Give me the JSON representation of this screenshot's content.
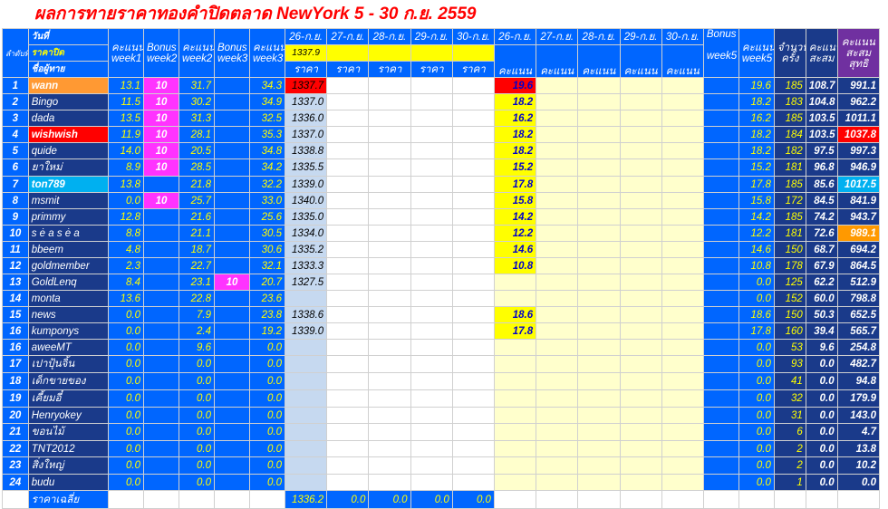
{
  "title": "ผลการทายราคาทองคำปิดตลาด NewYork 5 - 30 ก.ย. 2559",
  "header": {
    "rank_label": "ลำดับที่",
    "date_label": "วันที่",
    "close_label": "ราคาปิด",
    "name_label": "ชื่อผู้ทาย",
    "score_label": "คะแนน",
    "bonus_label": "Bonus",
    "week1": "week1",
    "week2": "week2",
    "week3": "week3",
    "week5": "week5",
    "price_label": "ราคา",
    "count_label": "จำนวนครั้ง",
    "accum_label": "คะแนนสะสม",
    "total_label": "คะแนนสะสมสุทธิ",
    "dates": [
      "26-ก.ย.",
      "27-ก.ย.",
      "28-ก.ย.",
      "29-ก.ย.",
      "30-ก.ย."
    ],
    "close_price_26": "1337.9"
  },
  "rows": [
    {
      "no": "1",
      "name": "wann",
      "w1": "13.1",
      "b2": "10",
      "w2": "31.7",
      "b3": "",
      "w3": "34.3",
      "p26": "1337.7",
      "s26": "19.6",
      "w5": "19.6",
      "cnt": "185",
      "acc": "108.7",
      "tot": "991.1",
      "nameHl": "orange",
      "priceHl": "red",
      "scoreHl": "red"
    },
    {
      "no": "2",
      "name": "Bingo",
      "w1": "11.5",
      "b2": "10",
      "w2": "30.2",
      "b3": "",
      "w3": "34.9",
      "p26": "1337.0",
      "s26": "18.2",
      "w5": "18.2",
      "cnt": "183",
      "acc": "104.8",
      "tot": "962.2"
    },
    {
      "no": "3",
      "name": "dada",
      "w1": "13.5",
      "b2": "10",
      "w2": "31.3",
      "b3": "",
      "w3": "32.5",
      "p26": "1336.0",
      "s26": "16.2",
      "w5": "16.2",
      "cnt": "185",
      "acc": "103.5",
      "tot": "1011.1"
    },
    {
      "no": "4",
      "name": "wishwish",
      "w1": "11.9",
      "b2": "10",
      "w2": "28.1",
      "b3": "",
      "w3": "35.3",
      "p26": "1337.0",
      "s26": "18.2",
      "w5": "18.2",
      "cnt": "184",
      "acc": "103.5",
      "tot": "1037.8",
      "nameHl": "red",
      "totHl": "red"
    },
    {
      "no": "5",
      "name": "quide",
      "w1": "14.0",
      "b2": "10",
      "w2": "20.5",
      "b3": "",
      "w3": "34.8",
      "p26": "1338.8",
      "s26": "18.2",
      "w5": "18.2",
      "cnt": "182",
      "acc": "97.5",
      "tot": "997.3"
    },
    {
      "no": "6",
      "name": "ยาใหม่",
      "w1": "8.9",
      "b2": "10",
      "w2": "28.5",
      "b3": "",
      "w3": "34.2",
      "p26": "1335.5",
      "s26": "15.2",
      "w5": "15.2",
      "cnt": "181",
      "acc": "96.8",
      "tot": "946.9"
    },
    {
      "no": "7",
      "name": "ton789",
      "w1": "13.8",
      "b2": "",
      "w2": "21.8",
      "b3": "",
      "w3": "32.2",
      "p26": "1339.0",
      "s26": "17.8",
      "w5": "17.8",
      "cnt": "185",
      "acc": "85.6",
      "tot": "1017.5",
      "nameHl": "cyan",
      "totHl": "cyan"
    },
    {
      "no": "8",
      "name": "msmit",
      "w1": "0.0",
      "b2": "10",
      "w2": "25.7",
      "b3": "",
      "w3": "33.0",
      "p26": "1340.0",
      "s26": "15.8",
      "w5": "15.8",
      "cnt": "172",
      "acc": "84.5",
      "tot": "841.9"
    },
    {
      "no": "9",
      "name": "primmy",
      "w1": "12.8",
      "b2": "",
      "w2": "21.6",
      "b3": "",
      "w3": "25.6",
      "p26": "1335.0",
      "s26": "14.2",
      "w5": "14.2",
      "cnt": "185",
      "acc": "74.2",
      "tot": "943.7"
    },
    {
      "no": "10",
      "name": "s ė a s ė a",
      "w1": "8.8",
      "b2": "",
      "w2": "21.1",
      "b3": "",
      "w3": "30.5",
      "p26": "1334.0",
      "s26": "12.2",
      "w5": "12.2",
      "cnt": "181",
      "acc": "72.6",
      "tot": "989.1",
      "totHl": "orange"
    },
    {
      "no": "11",
      "name": "bbeem",
      "w1": "4.8",
      "b2": "",
      "w2": "18.7",
      "b3": "",
      "w3": "30.6",
      "p26": "1335.2",
      "s26": "14.6",
      "w5": "14.6",
      "cnt": "150",
      "acc": "68.7",
      "tot": "694.2"
    },
    {
      "no": "12",
      "name": "goldmember",
      "w1": "2.3",
      "b2": "",
      "w2": "22.7",
      "b3": "",
      "w3": "32.1",
      "p26": "1333.3",
      "s26": "10.8",
      "w5": "10.8",
      "cnt": "178",
      "acc": "67.9",
      "tot": "864.5"
    },
    {
      "no": "13",
      "name": "GoldLenq",
      "w1": "8.4",
      "b2": "",
      "w2": "23.1",
      "b3": "10",
      "w3": "20.7",
      "p26": "1327.5",
      "s26": "",
      "w5": "0.0",
      "cnt": "125",
      "acc": "62.2",
      "tot": "512.9"
    },
    {
      "no": "14",
      "name": "monta",
      "w1": "13.6",
      "b2": "",
      "w2": "22.8",
      "b3": "",
      "w3": "23.6",
      "p26": "",
      "s26": "",
      "w5": "0.0",
      "cnt": "152",
      "acc": "60.0",
      "tot": "798.8"
    },
    {
      "no": "15",
      "name": "news",
      "w1": "0.0",
      "b2": "",
      "w2": "7.9",
      "b3": "",
      "w3": "23.8",
      "p26": "1338.6",
      "s26": "18.6",
      "w5": "18.6",
      "cnt": "150",
      "acc": "50.3",
      "tot": "652.5"
    },
    {
      "no": "16",
      "name": "kumponys",
      "w1": "0.0",
      "b2": "",
      "w2": "2.4",
      "b3": "",
      "w3": "19.2",
      "p26": "1339.0",
      "s26": "17.8",
      "w5": "17.8",
      "cnt": "160",
      "acc": "39.4",
      "tot": "565.7"
    },
    {
      "no": "16",
      "name": "aweeMT",
      "w1": "0.0",
      "b2": "",
      "w2": "9.6",
      "b3": "",
      "w3": "0.0",
      "p26": "",
      "s26": "",
      "w5": "0.0",
      "cnt": "53",
      "acc": "9.6",
      "tot": "254.8"
    },
    {
      "no": "17",
      "name": "เปาปุ้นจิ้น",
      "w1": "0.0",
      "b2": "",
      "w2": "0.0",
      "b3": "",
      "w3": "0.0",
      "p26": "",
      "s26": "",
      "w5": "0.0",
      "cnt": "93",
      "acc": "0.0",
      "tot": "482.7"
    },
    {
      "no": "18",
      "name": "เด็กขายของ",
      "w1": "0.0",
      "b2": "",
      "w2": "0.0",
      "b3": "",
      "w3": "0.0",
      "p26": "",
      "s26": "",
      "w5": "0.0",
      "cnt": "41",
      "acc": "0.0",
      "tot": "94.8"
    },
    {
      "no": "19",
      "name": "เคี้ยมอี๋",
      "w1": "0.0",
      "b2": "",
      "w2": "0.0",
      "b3": "",
      "w3": "0.0",
      "p26": "",
      "s26": "",
      "w5": "0.0",
      "cnt": "32",
      "acc": "0.0",
      "tot": "179.9"
    },
    {
      "no": "20",
      "name": "Henryokey",
      "w1": "0.0",
      "b2": "",
      "w2": "0.0",
      "b3": "",
      "w3": "0.0",
      "p26": "",
      "s26": "",
      "w5": "0.0",
      "cnt": "31",
      "acc": "0.0",
      "tot": "143.0"
    },
    {
      "no": "21",
      "name": "ขอนไม้",
      "w1": "0.0",
      "b2": "",
      "w2": "0.0",
      "b3": "",
      "w3": "0.0",
      "p26": "",
      "s26": "",
      "w5": "0.0",
      "cnt": "6",
      "acc": "0.0",
      "tot": "4.7"
    },
    {
      "no": "22",
      "name": "TNT2012",
      "w1": "0.0",
      "b2": "",
      "w2": "0.0",
      "b3": "",
      "w3": "0.0",
      "p26": "",
      "s26": "",
      "w5": "0.0",
      "cnt": "2",
      "acc": "0.0",
      "tot": "13.8"
    },
    {
      "no": "23",
      "name": "สิ่งใหญ่",
      "w1": "0.0",
      "b2": "",
      "w2": "0.0",
      "b3": "",
      "w3": "0.0",
      "p26": "",
      "s26": "",
      "w5": "0.0",
      "cnt": "2",
      "acc": "0.0",
      "tot": "10.2"
    },
    {
      "no": "24",
      "name": "budu",
      "w1": "0.0",
      "b2": "",
      "w2": "0.0",
      "b3": "",
      "w3": "0.0",
      "p26": "",
      "s26": "",
      "w5": "0.0",
      "cnt": "1",
      "acc": "0.0",
      "tot": "0.0"
    }
  ],
  "average": {
    "label": "ราคาเฉลี่ย",
    "values": [
      "1336.2",
      "0.0",
      "0.0",
      "0.0",
      "0.0"
    ]
  },
  "colors": {
    "blue": "#0066ff",
    "navy": "#1a3a8a",
    "yellow": "#ffff00",
    "pink": "#ff33ff",
    "red": "#ff0000",
    "cyan": "#00b0f0",
    "orange": "#ff9900",
    "purple": "#7030a0"
  }
}
